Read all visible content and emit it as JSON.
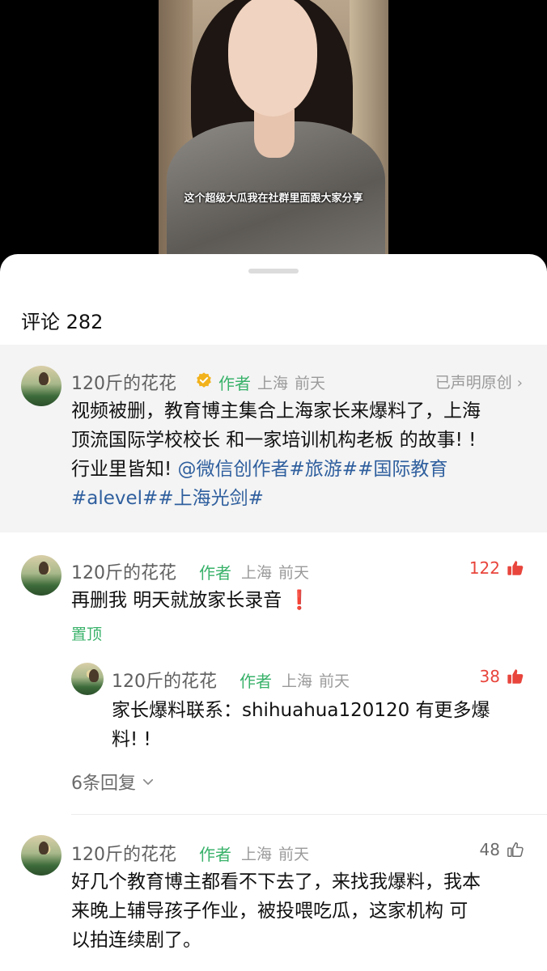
{
  "video": {
    "caption": "这个超级大瓜我在社群里面跟大家分享"
  },
  "comments_header": {
    "label": "评论 282"
  },
  "post": {
    "username": "120斤的花花",
    "author_tag": "作者",
    "location": "上海",
    "time": "前天",
    "original_claim": "已声明原创",
    "text_lines": [
      "视频被删，教育博主集合上海家长来爆料了，上海",
      "顶流国际学校校长 和一家培训机构老板 的故事! !"
    ],
    "line3_prefix": "行业里皆知! ",
    "mention": "@微信创作者",
    "tag_travel": "#旅游#",
    "tag_intl_edu": "#国际教育",
    "tag_alevel": "#alevel#",
    "tag_guangjian": "#上海光剑#"
  },
  "comments": [
    {
      "username": "120斤的花花",
      "author_tag": "作者",
      "location": "上海",
      "time": "前天",
      "likes": "122",
      "text": "再删我 明天就放家长录音",
      "emoji": "❗",
      "pinned": "置顶"
    },
    {
      "username": "120斤的花花",
      "author_tag": "作者",
      "location": "上海",
      "time": "前天",
      "likes": "38",
      "text_lines": [
        "家长爆料联系：shihuahua120120 有更多爆",
        "料! !"
      ]
    },
    {
      "username": "120斤的花花",
      "author_tag": "作者",
      "location": "上海",
      "time": "前天",
      "likes": "48",
      "text_lines": [
        "好几个教育博主都看不下去了，来找我爆料，我本",
        "来晚上辅导孩子作业，被投喂吃瓜，这家机构 可",
        "以拍连续剧了。"
      ]
    }
  ],
  "replies_toggle": {
    "label": "6条回复"
  },
  "colors": {
    "author_green": "#39b26a",
    "like_red": "#e8453c",
    "link_blue": "#2f5f9e",
    "verified_gold": "#f2b21c"
  },
  "icons": [
    "verified-badge-icon",
    "chevron-right-icon",
    "thumbs-up-filled-icon",
    "thumbs-up-outline-icon",
    "chevron-down-icon",
    "exclamation-emoji-icon"
  ]
}
